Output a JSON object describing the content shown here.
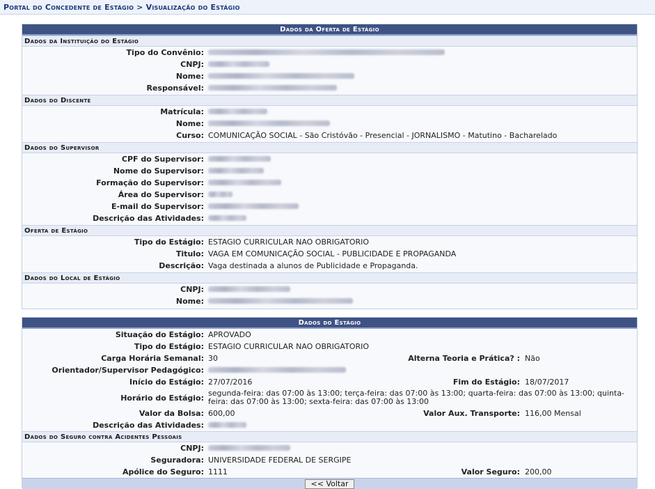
{
  "breadcrumb": "Portal do Concedente de Estágio > Visualização do Estágio",
  "oferta_panel": {
    "title": "Dados da Oferta de Estágio",
    "instituicao": {
      "title": "Dados da Instituição do Estágio",
      "tipo_convenio": "Tipo do Convênio:",
      "cnpj": "CNPJ:",
      "nome": "Nome:",
      "responsavel": "Responsável:"
    },
    "discente": {
      "title": "Dados do Discente",
      "matricula": "Matrícula:",
      "nome": "Nome:",
      "curso_label": "Curso:",
      "curso_value": "COMUNICAÇÃO SOCIAL - São Cristóvão - Presencial - JORNALISMO - Matutino - Bacharelado"
    },
    "supervisor": {
      "title": "Dados do Supervisor",
      "cpf": "CPF do Supervisor:",
      "nome": "Nome do Supervisor:",
      "formacao": "Formação do Supervisor:",
      "area": "Área do Supervisor:",
      "email": "E-mail do Supervisor:",
      "descricao": "Descrição das Atividades:"
    },
    "oferta": {
      "title": "Oferta de Estágio",
      "tipo_label": "Tipo do Estágio:",
      "tipo_value": "ESTAGIO CURRICULAR NAO OBRIGATORIO",
      "titulo_label": "Titulo:",
      "titulo_value": "VAGA EM COMUNICAÇÃO SOCIAL - PUBLICIDADE E PROPAGANDA",
      "descricao_label": "Descrição:",
      "descricao_value": "Vaga destinada a alunos de Publicidade e Propaganda."
    },
    "local": {
      "title": "Dados do Local de Estágio",
      "cnpj": "CNPJ:",
      "nome": "Nome:"
    }
  },
  "estagio_panel": {
    "title": "Dados do Estágio",
    "situacao_label": "Situação do Estágio:",
    "situacao_value": "APROVADO",
    "tipo_label": "Tipo do Estágio:",
    "tipo_value": "ESTAGIO CURRICULAR NAO OBRIGATORIO",
    "carga_label": "Carga Horária Semanal:",
    "carga_value": "30",
    "alterna_label": "Alterna Teoria e Prática? :",
    "alterna_value": "Não",
    "orientador_label": "Orientador/Supervisor Pedagógico:",
    "inicio_label": "Início do Estágio:",
    "inicio_value": "27/07/2016",
    "fim_label": "Fim do Estágio:",
    "fim_value": "18/07/2017",
    "horario_label": "Horário do Estágio:",
    "horario_value": "segunda-feira: das 07:00 às 13:00; terça-feira: das 07:00 às 13:00; quarta-feira: das 07:00 às 13:00; quinta-feira: das 07:00 às 13:00; sexta-feira: das 07:00 às 13:00",
    "bolsa_label": "Valor da Bolsa:",
    "bolsa_value": "600,00",
    "transporte_label": "Valor Aux. Transporte:",
    "transporte_value": "116,00 Mensal",
    "descricao_label": "Descrição das Atividades:",
    "seguro": {
      "title": "Dados do Seguro contra Acidentes Pessoais",
      "cnpj_label": "CNPJ:",
      "seguradora_label": "Seguradora:",
      "seguradora_value": "UNIVERSIDADE FEDERAL DE SERGIPE",
      "apolice_label": "Apólice do Seguro:",
      "apolice_value": "1111",
      "valor_label": "Valor Seguro:",
      "valor_value": "200,00"
    }
  },
  "voltar_button": "<< Voltar"
}
